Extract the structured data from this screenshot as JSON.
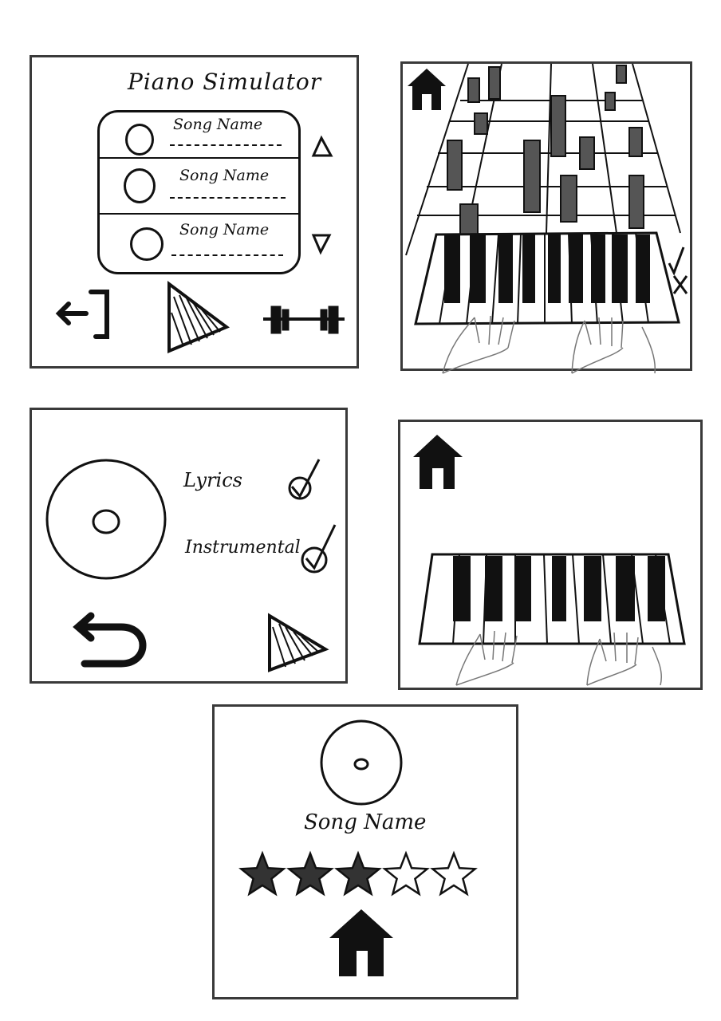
{
  "menu_screen": {
    "title": "Piano Simulator",
    "songs": [
      {
        "name": "Song Name"
      },
      {
        "name": "Song Name"
      },
      {
        "name": "Song Name"
      }
    ],
    "icons": [
      "scroll-up-triangle-icon",
      "scroll-down-triangle-icon",
      "exit-icon",
      "play-icon",
      "dumbbell-icon"
    ]
  },
  "play_screen": {
    "icons": [
      "home-icon",
      "check-icon",
      "close-icon"
    ]
  },
  "options_screen": {
    "options": [
      {
        "label": "Lyrics",
        "checked": true
      },
      {
        "label": "Instrumental",
        "checked": true
      }
    ],
    "icons": [
      "disc-icon",
      "back-arrow-icon",
      "play-icon"
    ]
  },
  "free_play_screen": {
    "icons": [
      "home-icon"
    ]
  },
  "result_screen": {
    "song_name": "Song Name",
    "rating": {
      "filled": 3,
      "total": 5
    },
    "icons": [
      "disc-icon",
      "home-icon"
    ]
  }
}
